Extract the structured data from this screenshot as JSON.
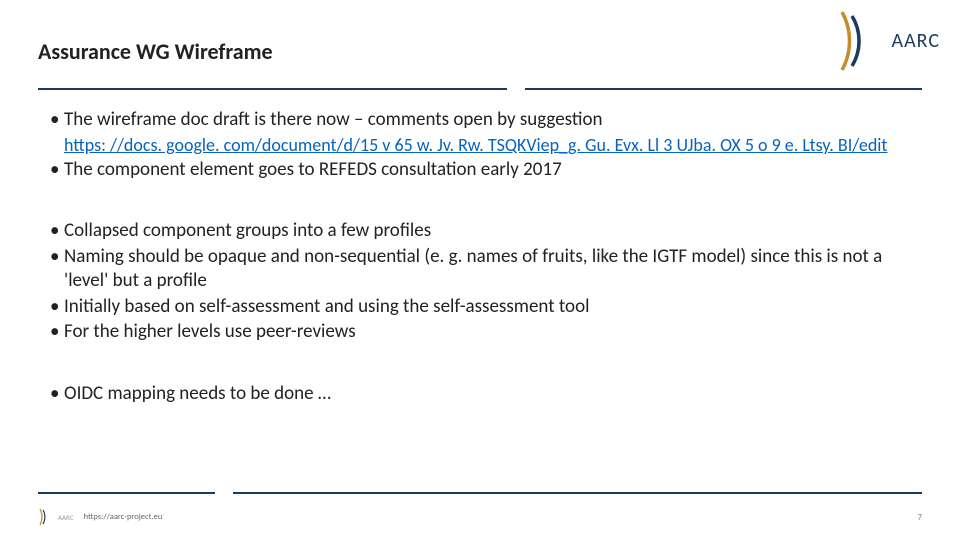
{
  "header": {
    "title": "Assurance WG Wireframe",
    "logo_text": "AARC"
  },
  "body": {
    "b1": "The wireframe doc draft is there now – comments open by suggestion",
    "link": "https: //docs. google. com/document/d/15 v 65 w. Jv. Rw. TSQKViep_g. Gu. Evx. Ll 3 UJba. OX 5 o 9 e. Ltsy. BI/edit",
    "b2": "The component element goes to REFEDS consultation early 2017",
    "b3": "Collapsed component groups into a few profiles",
    "b4": "Naming should be opaque and non-sequential (e. g. names of fruits, like the IGTF model) since this is not a 'level' but a profile",
    "b5": "Initially based on self-assessment and using the self-assessment tool",
    "b6": "For the higher levels use peer-reviews",
    "b7": "OIDC mapping needs to be done …"
  },
  "footer": {
    "mini_logo_text": "AARC",
    "url": "https://aarc-project.eu",
    "page": "7"
  }
}
